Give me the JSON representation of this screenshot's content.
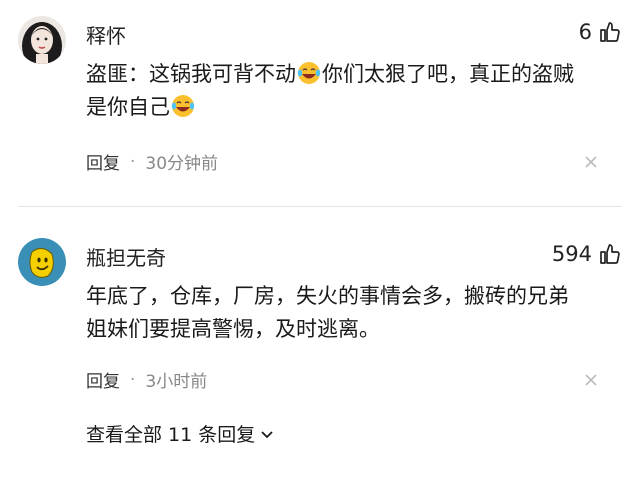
{
  "comments": [
    {
      "username": "释怀",
      "likes": "6",
      "text_line1_a": "盗匪：这锅我可背不动",
      "text_line1_b": "你们太狠了吧，真正的盗贼",
      "text_line2_a": "是你自己",
      "reply_label": "回复",
      "separator": "·",
      "time": "30分钟前",
      "avatar": "woman-portrait-avatar"
    },
    {
      "username": "瓶担无奇",
      "likes": "594",
      "text_line1": "年底了，仓库，厂房，失火的事情会多，搬砖的兄弟",
      "text_line2": "姐妹们要提高警惕，及时逃离。",
      "reply_label": "回复",
      "separator": "·",
      "time": "3小时前",
      "avatar": "yellow-smiley-avatar"
    }
  ],
  "view_all_replies": "查看全部 11 条回复",
  "icons": {
    "like": "thumbs-up-icon",
    "close": "close-icon",
    "emoji": "laughing-crying-emoji-icon",
    "expand": "chevron-down-icon"
  },
  "colors": {
    "text": "#1a1a1a",
    "meta": "#888888",
    "divider": "#e6e6e6"
  }
}
